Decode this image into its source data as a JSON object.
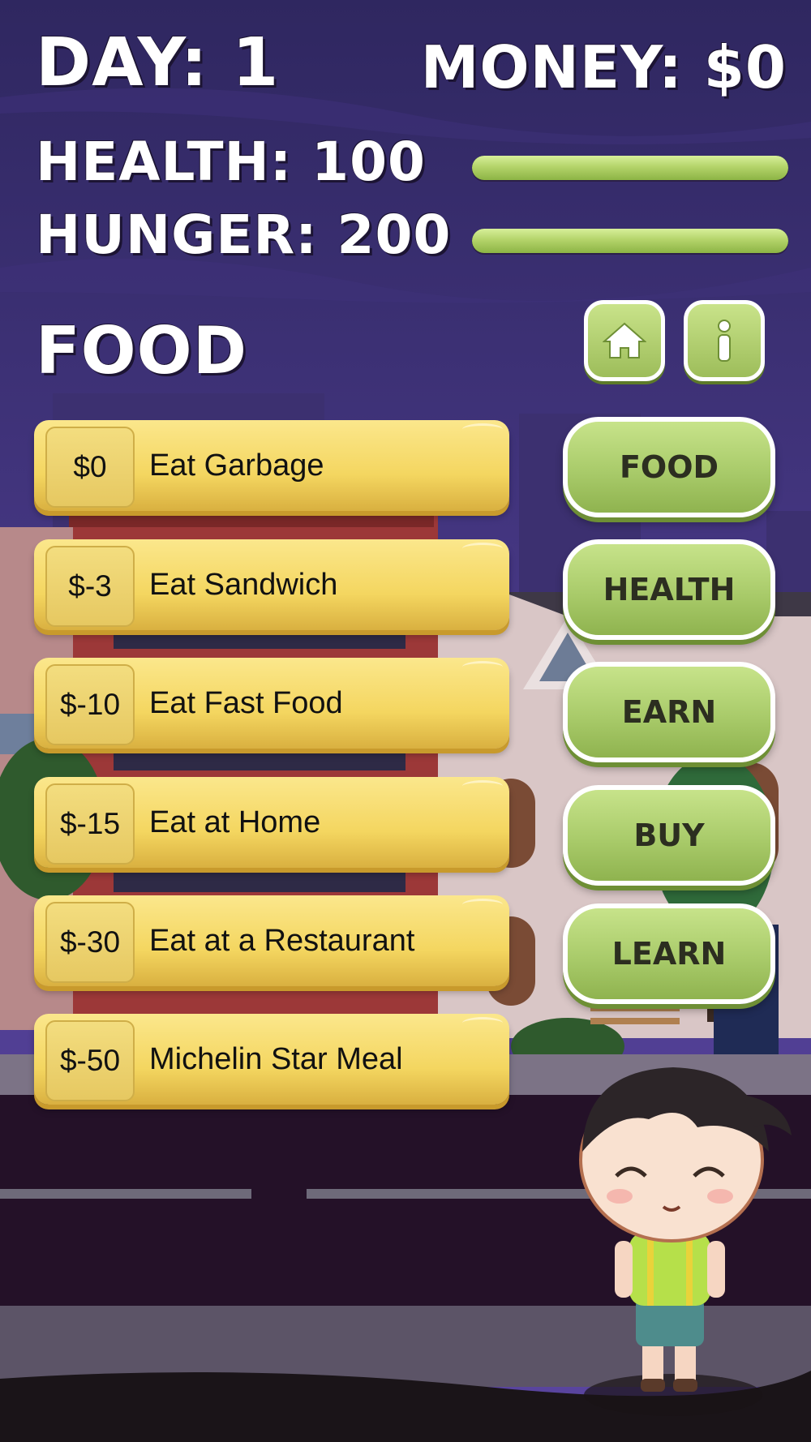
{
  "hud": {
    "day": "DAY: 1",
    "money": "MONEY: $0",
    "health": "HEALTH: 100",
    "hunger": "HUNGER: 200",
    "health_level": 1.0,
    "hunger_level": 1.0
  },
  "section_title": "FOOD",
  "icons": {
    "home": "home-icon",
    "info": "info-icon"
  },
  "items": [
    {
      "price": "$0",
      "label": "Eat Garbage"
    },
    {
      "price": "$-3",
      "label": "Eat Sandwich"
    },
    {
      "price": "$-10",
      "label": "Eat Fast Food"
    },
    {
      "price": "$-15",
      "label": "Eat at Home"
    },
    {
      "price": "$-30",
      "label": "Eat at a Restaurant"
    },
    {
      "price": "$-50",
      "label": "Michelin Star Meal"
    }
  ],
  "categories": [
    "FOOD",
    "HEALTH",
    "EARN",
    "BUY",
    "LEARN"
  ],
  "colors": {
    "sky": "#3a2f6e",
    "item_yellow": "#f4d660",
    "button_green": "#a9cb6a",
    "bar_green": "#b4d46a"
  }
}
